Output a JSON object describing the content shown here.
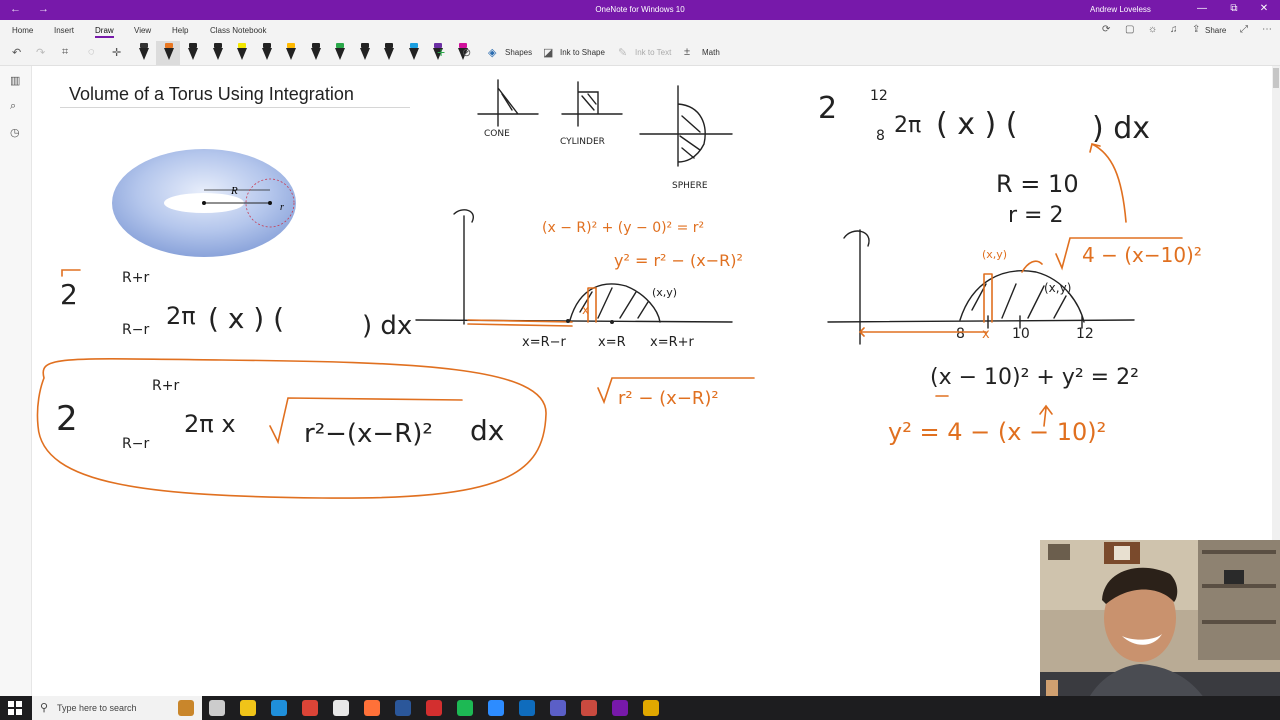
{
  "window": {
    "back_glyph": "←",
    "forward_glyph": "→",
    "title": "OneNote for Windows 10",
    "user": "Andrew Loveless",
    "minimize_glyph": "—",
    "maximize_glyph": "⧉",
    "close_glyph": "✕"
  },
  "menu": {
    "tabs": [
      "Home",
      "Insert",
      "Draw",
      "View",
      "Help",
      "Class Notebook"
    ],
    "share_label": "Share",
    "more_glyph": "⋯"
  },
  "toolbar": {
    "shapes_label": "Shapes",
    "ink_to_shape_label": "Ink to Shape",
    "ink_to_text_label": "Ink to Text",
    "math_label": "Math",
    "pen_colors": [
      "#333333",
      "#e87722",
      "#222222",
      "#222222",
      "#f2e600",
      "#222222",
      "#ffb900",
      "#222222",
      "#2aa84a",
      "#222222",
      "#222222",
      "#1a9fe0",
      "#6b2fa3",
      "#d0109b"
    ],
    "add_glyph": "+"
  },
  "page": {
    "title": "Volume of a Torus Using Integration"
  },
  "torus": {
    "label_R": "R",
    "label_r": "r"
  },
  "sketches": {
    "cone": "CONE",
    "cylinder": "CYLINDER",
    "sphere": "SPHERE"
  },
  "ink_text": {
    "two": "2",
    "two_pi": "2π",
    "two_pi_x": "2π x",
    "lim_hi": "R+r",
    "lim_lo": "R−r",
    "x_paren": "( x ) (",
    "dx": ") dx",
    "dx_only": "dx",
    "circle_eq": "(x − R)² + (y − 0)² = r²",
    "y_sq": "y² = r² − (x−R)²",
    "sqrt_mid": "r² − (x−R)²",
    "xy": "(x,y)",
    "x_eq_R_minus_r": "x=R−r",
    "x_mark": "x",
    "x_eq_R": "x=R",
    "x_eq_R_plus_r": "x=R+r",
    "big_sqrt": "r²−(x−R)²",
    "right_lim_hi": "12",
    "right_lim_lo": "8",
    "right_integrand": "( x ) (",
    "right_dx": ") dx",
    "R_eq": "R = 10",
    "r_eq": "r = 2",
    "sqrt_right": "4 − (x−10)²",
    "xy_right": "(x,y)",
    "tick_8": "8",
    "tick_x": "x",
    "tick_10": "10",
    "tick_12": "12",
    "eq_right_1": "(x − 10)² + y² = 2²",
    "eq_right_2": "y² = 4 − (x − 10)²"
  },
  "taskbar": {
    "search_placeholder": "Type here to search",
    "app_colors": [
      "#c9862b",
      "#cccccc",
      "#f0c419",
      "#1f8fda",
      "#db4437",
      "#e8e8e8",
      "#ff7139",
      "#2b579a",
      "#d32f2f",
      "#1db954",
      "#2d8cff",
      "#0f6cbd",
      "#5b5fc7",
      "#c94a3f",
      "#7719aa",
      "#e0a800"
    ]
  }
}
